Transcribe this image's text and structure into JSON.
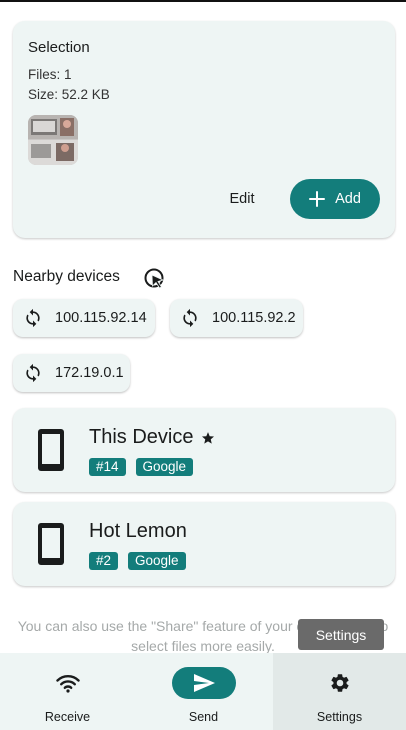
{
  "selection": {
    "title": "Selection",
    "files": "Files: 1",
    "size": "Size: 52.2 KB",
    "edit_label": "Edit",
    "add_label": "Add"
  },
  "nearby": {
    "title": "Nearby devices",
    "addresses": [
      "100.115.92.14",
      "100.115.92.2",
      "172.19.0.1"
    ]
  },
  "devices": [
    {
      "name": "This Device",
      "favorite": true,
      "tag_id": "#14",
      "tag_vendor": "Google"
    },
    {
      "name": "Hot Lemon",
      "favorite": false,
      "tag_id": "#2",
      "tag_vendor": "Google"
    }
  ],
  "hint": {
    "text": "You can also use the \"Share\" feature of your other device to select files more easily."
  },
  "tooltip": {
    "text": "Settings"
  },
  "nav": {
    "receive": "Receive",
    "send": "Send",
    "settings": "Settings"
  },
  "colors": {
    "accent": "#137d7b",
    "card": "#eef5f4",
    "nav_selected": "#e2e9e8"
  }
}
